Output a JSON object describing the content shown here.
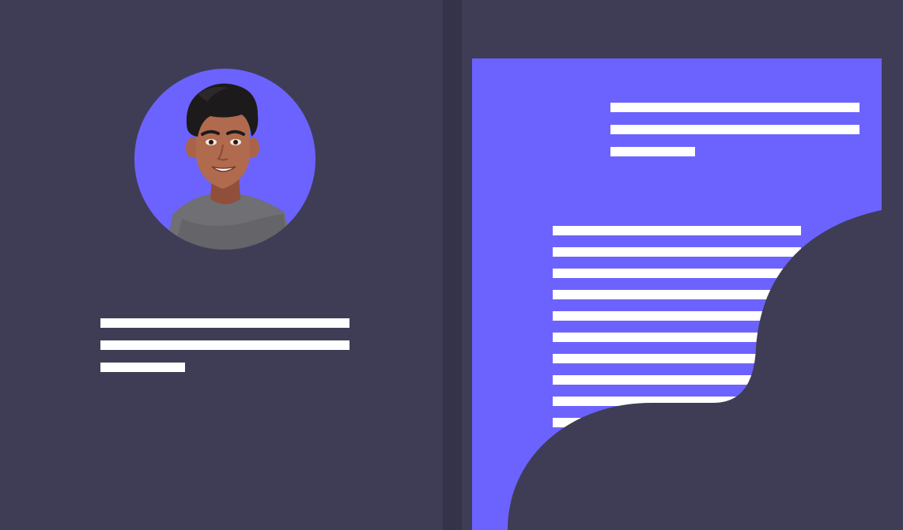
{
  "colors": {
    "background": "#3f3d56",
    "divider": "#35334a",
    "accent": "#6c63ff",
    "text_bars": "#ffffff",
    "skin": "#b06a4e",
    "hair": "#1d1a1c",
    "shirt": "#6f6f74"
  },
  "left_panel": {
    "avatar_icon": "user-avatar-icon",
    "placeholder_text_lines": 3
  },
  "right_panel": {
    "document_icon": "document-icon",
    "header_placeholder_lines": 3,
    "body_placeholder_lines": 10
  }
}
